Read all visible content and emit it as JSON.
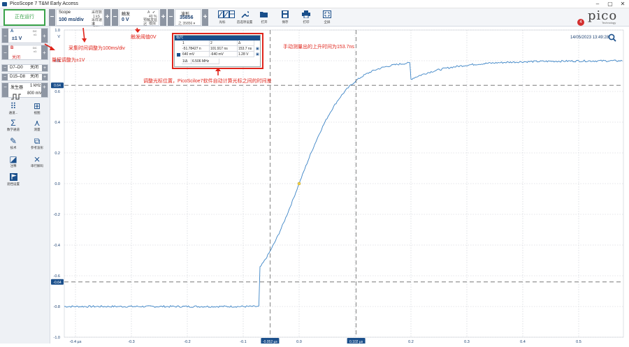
{
  "window": {
    "title": "PicoScope 7 T&M Early Access",
    "controls": [
      "–",
      "▢",
      "✕"
    ]
  },
  "toolbar": {
    "run_button": "正在运行",
    "scope": {
      "label": "Scope",
      "value": "100 ms/div",
      "sub_labels": [
        "采样数",
        "1 kS",
        "采样速率",
        "1 GS/s"
      ]
    },
    "trigger": {
      "label": "触发",
      "value": "0 V",
      "sub_labels": [
        "A",
        "✔",
        "40 %",
        "预触发延迟",
        "模拟"
      ]
    },
    "waveform": {
      "label": "波形",
      "value": "35856",
      "sub": "之 35856 ▾"
    },
    "tools": [
      {
        "icon": "cursor-measure-icon",
        "label": "光标"
      },
      {
        "icon": "wrench-icon",
        "label": "首选项设置"
      },
      {
        "icon": "folder-open-icon",
        "label": "打开"
      },
      {
        "icon": "save-icon",
        "label": "保存"
      },
      {
        "icon": "print-icon",
        "label": "打印"
      },
      {
        "icon": "fullscreen-icon",
        "label": "全屏"
      }
    ],
    "brand": "pico",
    "brand_sub": "Technology",
    "notification_count": "4"
  },
  "sidebar": {
    "channel_a": {
      "name": "A",
      "coupling": "DC",
      "probe": "x1",
      "range": "±1 V"
    },
    "channel_b": {
      "name": "B",
      "coupling": "DC",
      "probe": "x1",
      "state": "关闭"
    },
    "digital_rows": [
      {
        "label": "D7–D0",
        "state": "关闭"
      },
      {
        "label": "D15–D8",
        "state": "关闭"
      }
    ],
    "generator": {
      "label": "发生器",
      "freq": "1 kHz",
      "amp": "800 mV"
    },
    "tools": [
      {
        "icon": "grid-dots-icon",
        "label": "通道..."
      },
      {
        "icon": "view-grid-icon",
        "label": "视图"
      },
      {
        "icon": "sigma-icon",
        "label": "数学通道"
      },
      {
        "icon": "measure-icon",
        "label": "测量"
      },
      {
        "icon": "edit-icon",
        "label": "技术"
      },
      {
        "icon": "reference-icon",
        "label": "参考波形"
      },
      {
        "icon": "note-icon",
        "label": "注释"
      },
      {
        "icon": "decode-icon",
        "label": "串行解码"
      },
      {
        "icon": "flag-icon",
        "label": "遮挡设置"
      }
    ]
  },
  "plot": {
    "timestamp": "14/05/2023 13:49:28",
    "y_unit": "V",
    "y_ticks": [
      "1.0",
      "0.8",
      "0.6",
      "0.4",
      "0.2",
      "0.0",
      "-0.2",
      "-0.4",
      "-0.6",
      "-0.8",
      "-1.0"
    ],
    "x_ticks": [
      "-0.4 µs",
      "-0.3",
      "-0.2",
      "-0.1",
      "0.0",
      "0.1",
      "0.2",
      "0.3",
      "0.4",
      "0.5"
    ],
    "h_cursor_labels": [
      "0.64",
      "-0.64"
    ],
    "v_cursor_labels": [
      "-0.052 µs",
      "0.102 µs"
    ],
    "ruler_table": {
      "title": "标尺",
      "header": [
        "1",
        "2",
        "Δ"
      ],
      "row1": [
        "-51.78427 n",
        "101.917 ns",
        "153.7 ns"
      ],
      "row2": [
        "640 mV",
        "-640 mV",
        "1.28 V"
      ],
      "freq_label": "1/Δ",
      "freq_value": "6.506 MHz"
    }
  },
  "annotations": {
    "time_base": "采集时间调整为100ms/div",
    "range": "量程调整为±1V",
    "trigger": "触发阈值0V",
    "rise_time": "手动测量出的上升时间为153.7ns",
    "cursor_note": "调整光标位置，PicoSciloe7软件自动计算光标之间的时间差"
  },
  "colors": {
    "accent": "#1a4f8b",
    "trace": "#3c84c6",
    "annotation": "#e0251b",
    "run": "#3aa34a"
  }
}
